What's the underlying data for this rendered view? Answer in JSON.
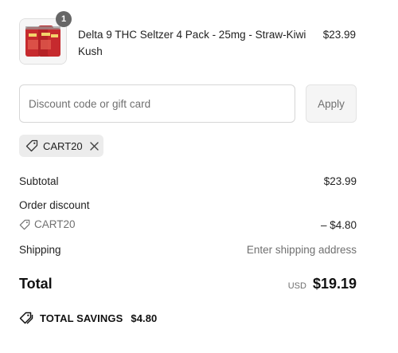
{
  "cart": {
    "items": [
      {
        "quantity": "1",
        "name": "Delta 9 THC Seltzer 4 Pack - 25mg - Straw-Kiwi Kush",
        "price": "$23.99",
        "image_icon": "seltzer-can-pack-image",
        "image_color": "#c62a2e"
      }
    ]
  },
  "discount": {
    "placeholder": "Discount code or gift card",
    "value": "",
    "apply_label": "Apply",
    "applied_code": "CART20"
  },
  "summary": {
    "subtotal_label": "Subtotal",
    "subtotal_value": "$23.99",
    "order_discount_label": "Order discount",
    "discount_code": "CART20",
    "discount_value": "– $4.80",
    "shipping_label": "Shipping",
    "shipping_value": "Enter shipping address",
    "total_label": "Total",
    "currency": "USD",
    "total_value": "$19.19",
    "savings_label": "TOTAL SAVINGS",
    "savings_value": "$4.80"
  },
  "colors": {
    "muted_text": "#707070",
    "chip_bg": "#ececec",
    "badge_bg": "#666666"
  }
}
